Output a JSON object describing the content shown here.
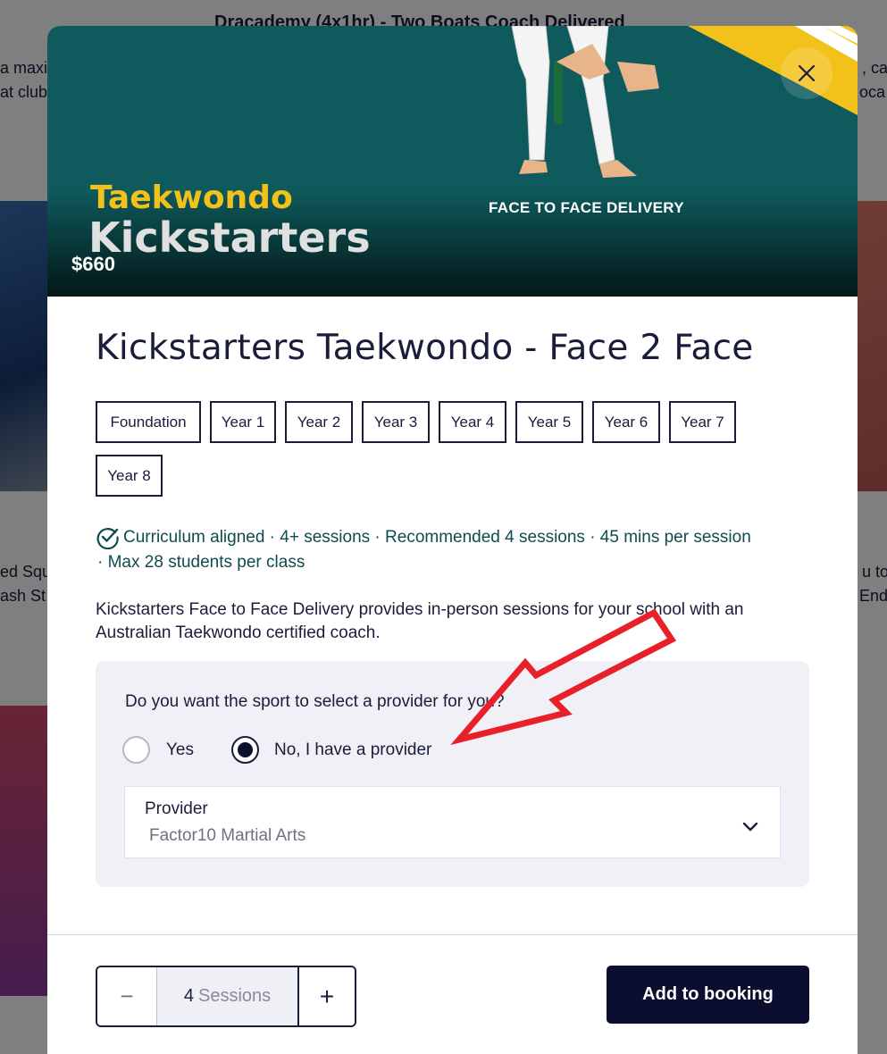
{
  "background": {
    "card_title": "Dracademy (4x1hr) - Two Boats Coach Delivered",
    "left_fragments": [
      "a maxi",
      "at club",
      "ed Squ",
      "ash St"
    ],
    "right_fragments": [
      ", ca",
      "oca",
      "u to",
      "End"
    ]
  },
  "hero": {
    "logo_line1": "Taekwondo",
    "logo_line2": "Kickstarters",
    "delivery_label": "FACE TO FACE DELIVERY",
    "price": "$660"
  },
  "modal": {
    "title": "Kickstarters Taekwondo - Face 2 Face",
    "year_tags": [
      "Foundation",
      "Year 1",
      "Year 2",
      "Year 3",
      "Year 4",
      "Year 5",
      "Year 6",
      "Year 7",
      "Year 8"
    ],
    "meta_line1": "Curriculum aligned · 4+ sessions · Recommended 4 sessions · 45 mins per session",
    "meta_line2": "· Max 28 students per class",
    "description": "Kickstarters Face to Face Delivery provides in-person sessions for your school with an Australian Taekwondo certified coach."
  },
  "provider": {
    "question": "Do you want the sport to select a provider for you?",
    "options": [
      {
        "label": "Yes",
        "selected": false
      },
      {
        "label": "No, I have a provider",
        "selected": true
      }
    ],
    "select_label": "Provider",
    "select_value": "Factor10 Martial Arts"
  },
  "footer": {
    "sessions_count": "4",
    "sessions_unit": "Sessions",
    "minus_symbol": "−",
    "plus_symbol": "+",
    "add_button": "Add to booking"
  },
  "colors": {
    "primary": "#0b0e2f",
    "hero_bg": "#0e5a5c",
    "logo_yellow": "#f2c21b",
    "meta_teal": "#0e4c4f",
    "annotation_red": "#e8202a"
  },
  "icons": {
    "close": "close-icon",
    "check": "check-circle-icon",
    "chevron": "chevron-down-icon"
  }
}
